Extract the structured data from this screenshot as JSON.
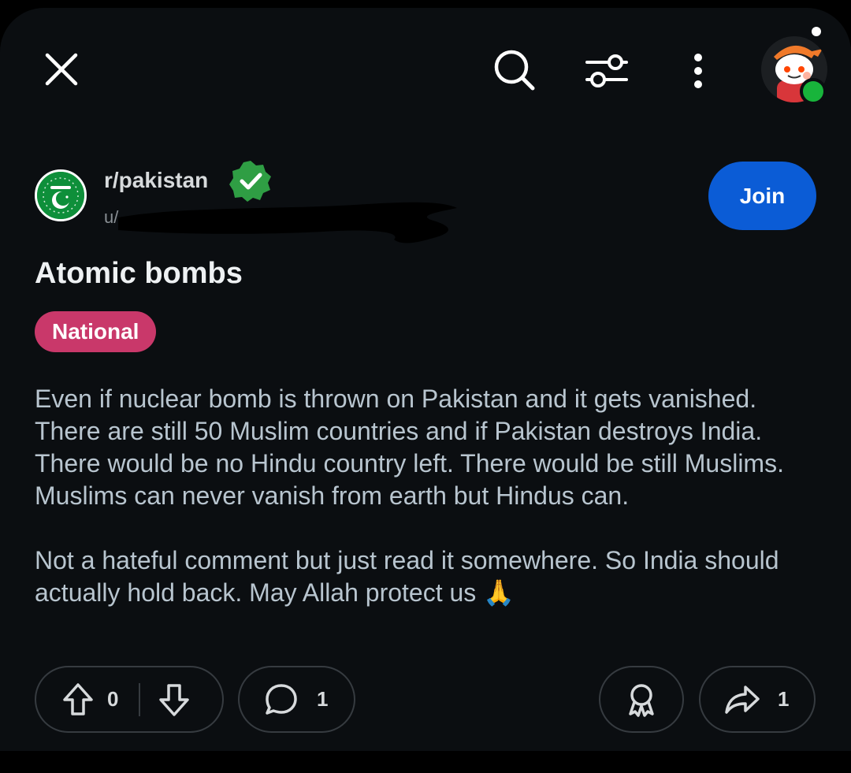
{
  "header": {
    "close_icon": "close-icon",
    "search_icon": "search-icon",
    "sort_icon": "tune-icon",
    "more_icon": "more-vertical-icon",
    "avatar_icon": "snoo-avatar",
    "online_color": "#18b43b"
  },
  "post": {
    "subreddit": "r/pakistan",
    "user_prefix": "u/",
    "join_label": "Join",
    "title": "Atomic bombs",
    "flair": "National",
    "flair_color": "#c9386a",
    "body": [
      "Even if nuclear bomb is thrown on Pakistan and it gets vanished. There are still 50 Muslim countries and if Pakistan destroys India. There would be no Hindu country left. There would be still Muslims. Muslims can never vanish from earth but Hindus can.",
      "Not a hateful comment but just read it somewhere. So India should actually hold back. May Allah protect us 🙏"
    ]
  },
  "actions": {
    "votes": "0",
    "comments": "1",
    "shares": "1"
  },
  "colors": {
    "join": "#0b5cd6",
    "background": "#0b0e11",
    "verified": "#2f9e44"
  }
}
